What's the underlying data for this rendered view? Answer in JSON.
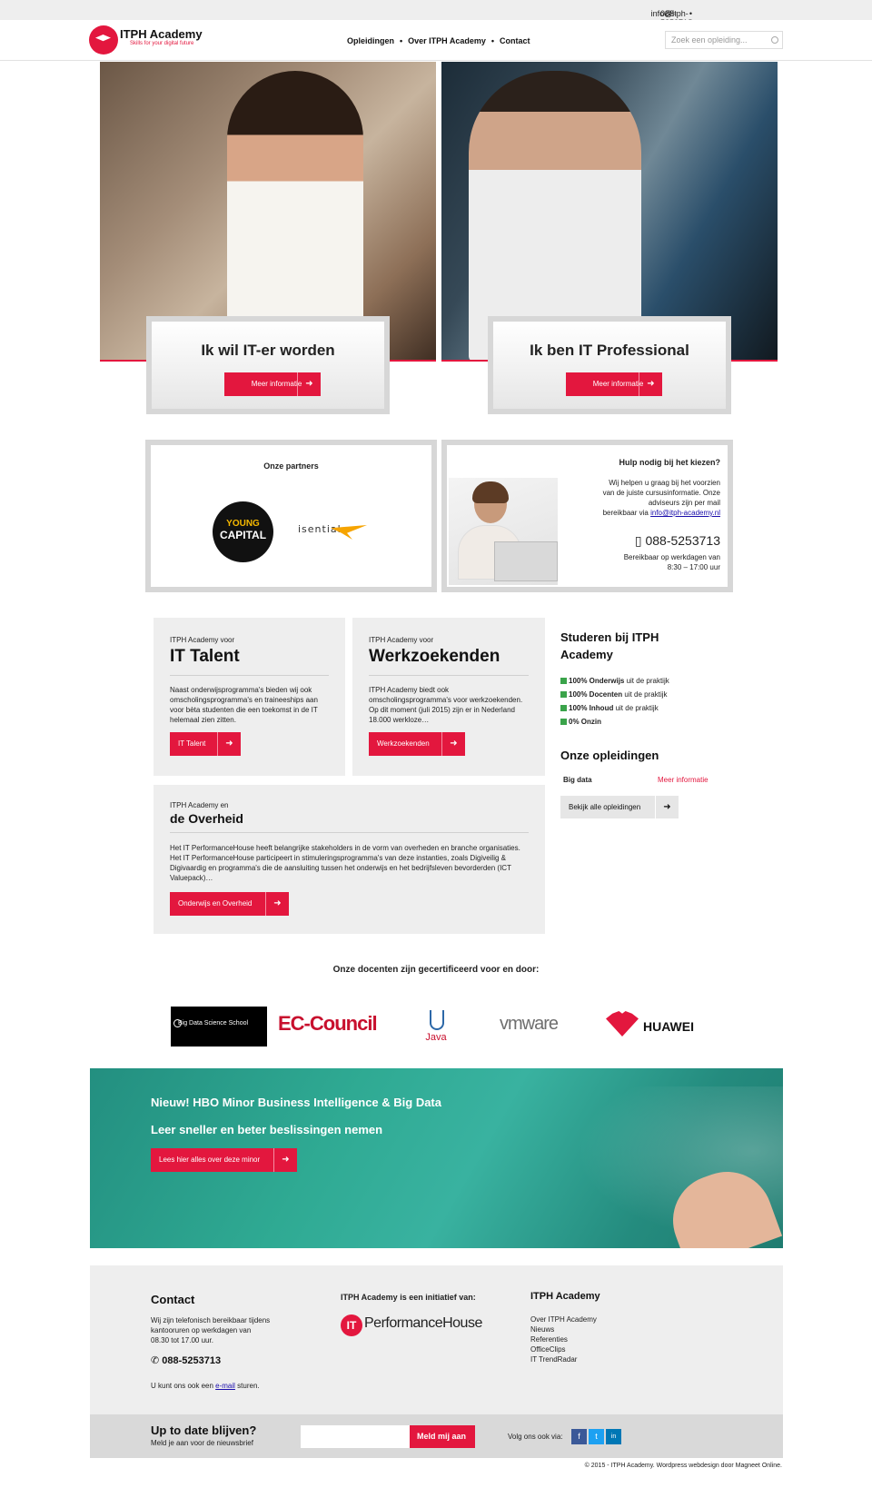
{
  "topbar": {
    "phone": "088-5253713",
    "sep": "•",
    "email": "info@itph-academy.nl"
  },
  "header": {
    "logo_title": "ITPH Academy",
    "logo_tagline": "Skills for your digital future",
    "nav": [
      "Opleidingen",
      "Over ITPH Academy",
      "Contact"
    ],
    "nav_sep": "•",
    "search_placeholder": "Zoek een opleiding..."
  },
  "hero_cards": [
    {
      "title": "Ik wil IT-er worden",
      "button": "Meer informatie"
    },
    {
      "title": "Ik ben IT Professional",
      "button": "Meer informatie"
    }
  ],
  "partners": {
    "title": "Onze partners",
    "logos": [
      "YOUNG",
      "CAPITAL",
      "isential"
    ]
  },
  "help": {
    "title": "Hulp nodig bij het kiezen?",
    "desc_lines": [
      "Wij helpen u graag bij het voorzien",
      "van de juiste cursusinformatie. Onze",
      "adviseurs zijn per mail",
      "bereikbaar via"
    ],
    "email": "info@itph-academy.nl",
    "phone": "088-5253713",
    "hours_lines": [
      "Bereikbaar op werkdagen van",
      "8:30 – 17:00 uur"
    ]
  },
  "tiles": [
    {
      "small": "ITPH Academy voor",
      "big": "IT Talent",
      "body": "Naast onderwijsprogramma's bieden wij ook omscholingsprogramma's en traineeships aan voor bèta studenten die een toekomst in de IT helemaal zien zitten.",
      "button": "IT Talent"
    },
    {
      "small": "ITPH Academy voor",
      "big": "Werkzoekenden",
      "body": "ITPH Academy biedt ook omscholingsprogramma's voor werkzoekenden. Op dit moment (juli 2015) zijn er in Nederland 18.000 werkloze…",
      "button": "Werkzoekenden"
    },
    {
      "small": "ITPH Academy en",
      "big": "de Overheid",
      "body": "Het IT PerformanceHouse heeft belangrijke stakeholders in de vorm van overheden en branche organisaties. Het IT PerformanceHouse participeert in stimuleringsprogramma's van deze instanties, zoals Digiveilig & Digivaardig en programma's die de aansluiting tussen het onderwijs en het bedrijfsleven bevorderden (ICT Valuepack)…",
      "button": "Onderwijs en Overheid"
    }
  ],
  "side": {
    "study_title": "Studeren bij ITPH Academy",
    "checks": [
      {
        "bold": "100% Onderwijs",
        "rest": " uit de praktijk"
      },
      {
        "bold": "100% Docenten",
        "rest": " uit de praktijk"
      },
      {
        "bold": "100% Inhoud",
        "rest": " uit de praktijk"
      },
      {
        "bold": "0% Onzin",
        "rest": ""
      }
    ],
    "courses_title": "Onze opleidingen",
    "course_name": "Big data",
    "course_link": "Meer informatie",
    "all_button": "Bekijk alle opleidingen"
  },
  "certs": {
    "title": "Onze docenten zijn gecertificeerd voor en door:",
    "logos": [
      "Big Data Science School",
      "EC-Council",
      "Java",
      "vmware",
      "HUAWEI"
    ]
  },
  "banner": {
    "line1": "Nieuw! HBO Minor Business Intelligence & Big Data",
    "line2": "Leer sneller en beter beslissingen nemen",
    "button": "Lees hier alles over deze minor"
  },
  "footer": {
    "contact_title": "Contact",
    "contact_text_lines": [
      "Wij zijn telefonisch bereikbaar tijdens",
      "kantooruren op werkdagen van",
      "08.30 tot 17.00 uur."
    ],
    "contact_phone": "088-5253713",
    "contact_mail_prefix": "U kunt ons ook een ",
    "contact_mail_link": "e-mail",
    "contact_mail_suffix": " sturen.",
    "initiative_title": "ITPH Academy is een initiatief van:",
    "initiative_logo_mark": "IT",
    "initiative_logo_text": "PerformanceHouse",
    "links_title": "ITPH Academy",
    "links": [
      "Over ITPH Academy",
      "Nieuws",
      "Referenties",
      "OfficeClips",
      "IT TrendRadar"
    ]
  },
  "newsletter": {
    "title": "Up to date blijven?",
    "sub": "Meld je aan voor de nieuwsbrief",
    "button": "Meld mij aan",
    "follow": "Volg ons ook via:",
    "socials": [
      "f",
      "t",
      "in"
    ]
  },
  "copyright": "© 2015 - ITPH Academy. Wordpress webdesign door Magneet Online.",
  "colors": {
    "accent": "#e3173e",
    "panel": "#eeeeee",
    "banner": "#2faa93"
  }
}
